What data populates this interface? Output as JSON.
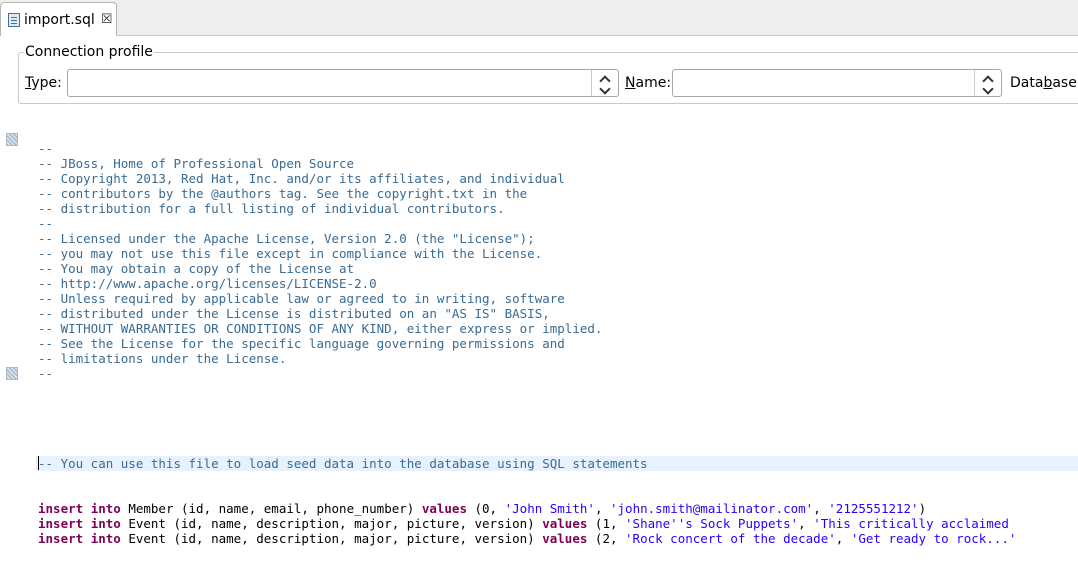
{
  "tab": {
    "title": "import.sql",
    "close_glyph": "☒",
    "icon": "sql-file-icon"
  },
  "connection_profile": {
    "legend": "Connection profile",
    "type": {
      "mnemonic": "T",
      "rest": "ype:",
      "value": ""
    },
    "name": {
      "mnemonic": "N",
      "rest": "ame:",
      "value": ""
    },
    "database": {
      "before": "Data",
      "mnemonic": "b",
      "rest": "ase:"
    }
  },
  "editor": {
    "license_comment": [
      "--",
      "-- JBoss, Home of Professional Open Source",
      "-- Copyright 2013, Red Hat, Inc. and/or its affiliates, and individual",
      "-- contributors by the @authors tag. See the copyright.txt in the",
      "-- distribution for a full listing of individual contributors.",
      "--",
      "-- Licensed under the Apache License, Version 2.0 (the \"License\");",
      "-- you may not use this file except in compliance with the License.",
      "-- You may obtain a copy of the License at",
      "-- http://www.apache.org/licenses/LICENSE-2.0",
      "-- Unless required by applicable law or agreed to in writing, software",
      "-- distributed under the License is distributed on an \"AS IS\" BASIS,",
      "-- WITHOUT WARRANTIES OR CONDITIONS OF ANY KIND, either express or implied.",
      "-- See the License for the specific language governing permissions and",
      "-- limitations under the License.",
      "--"
    ],
    "seed_comment": "-- You can use this file to load seed data into the database using SQL statements",
    "statements": [
      {
        "kw1": "insert",
        "kw2": "into",
        "mid": " Member (id, name, email, phone_number) ",
        "kw3": "values",
        "pre": " (0, ",
        "s1": "'John Smith'",
        "sep1": ", ",
        "s2": "'john.smith@mailinator.com'",
        "sep2": ", ",
        "s3": "'2125551212'",
        "tail": ")"
      },
      {
        "kw1": "insert",
        "kw2": "into",
        "mid": " Event (id, name, description, major, picture, version) ",
        "kw3": "values",
        "pre": " (1, ",
        "s1": "'Shane''s Sock Puppets'",
        "sep1": ", ",
        "s2": "'This critically acclaimed",
        "sep2": "",
        "s3": "",
        "tail": ""
      },
      {
        "kw1": "insert",
        "kw2": "into",
        "mid": " Event (id, name, description, major, picture, version) ",
        "kw3": "values",
        "pre": " (2, ",
        "s1": "'Rock concert of the decade'",
        "sep1": ", ",
        "s2": "'Get ready to rock...'",
        "sep2": "",
        "s3": "",
        "tail": ""
      }
    ]
  }
}
